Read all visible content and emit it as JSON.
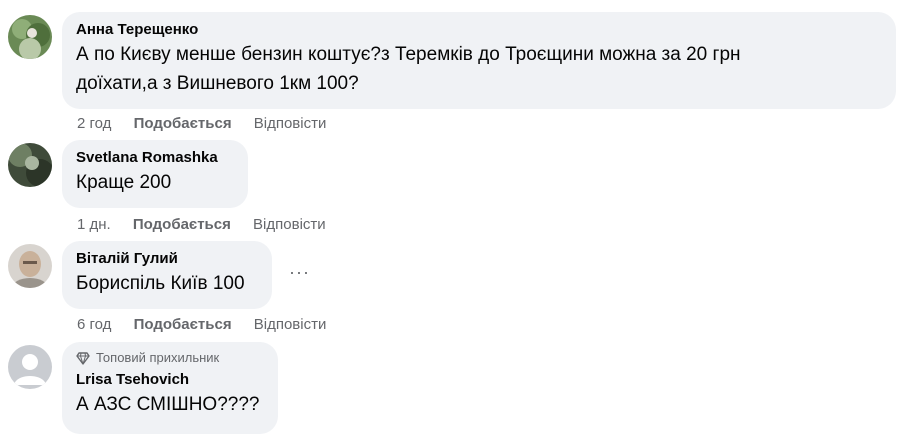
{
  "comments": [
    {
      "author": "Анна Терещенко",
      "text_line1": "А по Києву менше бензин коштує?з Теремків до Троєщини можна за 20 грн",
      "text_line2": "доїхати,а з Вишневого 1км 100?",
      "time": "2 год",
      "like": "Подобається",
      "reply": "Відповісти"
    },
    {
      "author": "Svetlana Romashka",
      "text": "Краще 200",
      "time": "1 дн.",
      "like": "Подобається",
      "reply": "Відповісти"
    },
    {
      "author": "Віталій Гулий",
      "text": "Бориспіль Київ 100",
      "more": "···",
      "time": "6 год",
      "like": "Подобається",
      "reply": "Відповісти"
    },
    {
      "badge": "Топовий прихильник",
      "author": "Lrisa Tsehovich",
      "text": "А АЗС СМІШНО????"
    }
  ],
  "icons": {
    "badge_icon": "diamond-icon",
    "more_icon": "more-options-icon"
  },
  "colors": {
    "bubble": "#f0f2f5",
    "meta": "#65676b",
    "text": "#050505"
  }
}
